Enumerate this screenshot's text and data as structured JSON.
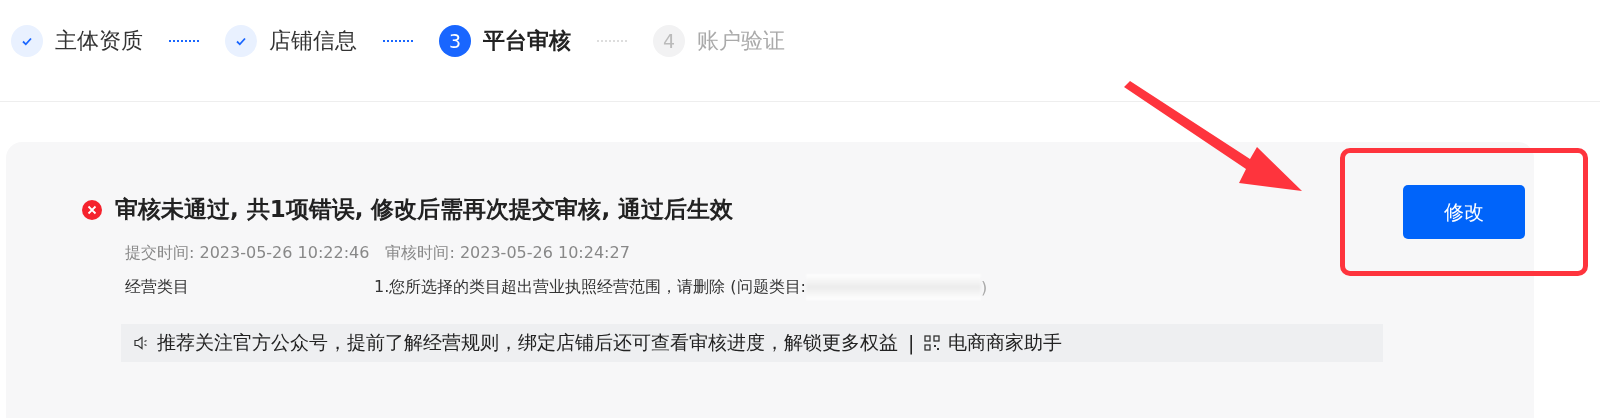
{
  "steps": [
    {
      "label": "主体资质",
      "kind": "done"
    },
    {
      "label": "店铺信息",
      "kind": "done"
    },
    {
      "label": "平台审核",
      "kind": "current",
      "number": "3"
    },
    {
      "label": "账户验证",
      "kind": "pending",
      "number": "4"
    }
  ],
  "review": {
    "kind": "rejected",
    "title": "审核未通过, 共1项错误, 修改后需再次提交审核, 通过后生效",
    "meta": [
      "提交时间: 2023-05-26 10:22:46",
      "审核时间: 2023-05-26 10:24:27"
    ],
    "issues": [
      {
        "label": "经营类目",
        "detail": "1.您所选择的类目超出营业执照经营范围，请删除 (问题类目:",
        "detail_end": ")",
        "redacted": true
      }
    ],
    "edit_button": "修改",
    "highlighted": true
  },
  "notice": {
    "text": "推荐关注官方公众号，提前了解经营规则，绑定店铺后还可查看审核进度，解锁更多权益",
    "separator": "|",
    "link": "电商商家助手"
  }
}
